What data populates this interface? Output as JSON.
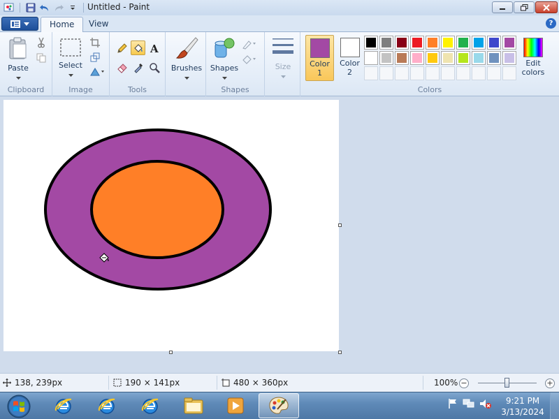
{
  "window": {
    "title": "Untitled - Paint"
  },
  "tabs": [
    {
      "label": "Home"
    },
    {
      "label": "View"
    }
  ],
  "ribbon": {
    "clipboard": {
      "label": "Clipboard",
      "paste": "Paste"
    },
    "image": {
      "label": "Image",
      "select": "Select"
    },
    "tools": {
      "label": "Tools"
    },
    "brushes": {
      "label": "Brushes"
    },
    "shapes": {
      "label": "Shapes",
      "button": "Shapes"
    },
    "size": {
      "label": "Size"
    },
    "colors": {
      "label": "Colors",
      "color1": {
        "label": "Color",
        "sub": "1",
        "value": "#a349a4"
      },
      "color2": {
        "label": "Color",
        "sub": "2",
        "value": "#ffffff"
      },
      "edit": {
        "label": "Edit",
        "sub": "colors"
      },
      "palette_row1": [
        "#000000",
        "#7f7f7f",
        "#880015",
        "#ed1c24",
        "#ff7f27",
        "#fff200",
        "#22b14c",
        "#00a2e8",
        "#3f48cc",
        "#a349a4"
      ],
      "palette_row2": [
        "#ffffff",
        "#c3c3c3",
        "#b97a57",
        "#ffaec9",
        "#ffc90e",
        "#efe4b0",
        "#b5e61d",
        "#99d9ea",
        "#7092be",
        "#c8bfe7"
      ]
    }
  },
  "canvas": {
    "outer_fill": "#a349a4",
    "inner_fill": "#ff7f27",
    "outline": "#000000"
  },
  "status": {
    "cursor": "138, 239px",
    "selection": "190 × 141px",
    "canvas_size": "480 × 360px",
    "zoom": "100%",
    "zoom_out": "−",
    "zoom_in": "+"
  },
  "taskbar": {
    "time": "9:21 PM",
    "date": "3/13/2024"
  }
}
